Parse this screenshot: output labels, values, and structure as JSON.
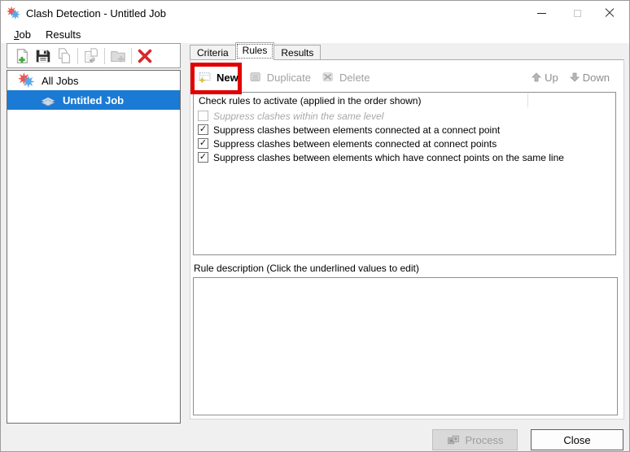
{
  "window": {
    "title": "Clash Detection - Untitled Job"
  },
  "menu": {
    "job": {
      "accel": "J",
      "rest": "ob"
    },
    "results": "Results"
  },
  "left_toolbar": {
    "icons": [
      "new-job-icon",
      "save-icon",
      "copy-icon",
      "paste-job-icon",
      "add-folder-icon",
      "delete-job-icon"
    ]
  },
  "tree": {
    "items": [
      {
        "label": "All Jobs",
        "selected": false
      },
      {
        "label": "Untitled Job",
        "selected": true
      }
    ]
  },
  "tabs": {
    "items": [
      {
        "label": "Criteria",
        "active": false
      },
      {
        "label": "Rules",
        "active": true
      },
      {
        "label": "Results",
        "active": false
      }
    ]
  },
  "rules_toolbar": {
    "new_label": "New",
    "duplicate_label": "Duplicate",
    "delete_label": "Delete",
    "up_label": "Up",
    "down_label": "Down",
    "new_enabled": true,
    "duplicate_enabled": false,
    "delete_enabled": false
  },
  "rules_list": {
    "header": "Check rules to activate (applied in the order shown)",
    "items": [
      {
        "label": "Suppress clashes within the same level",
        "checked": false,
        "disabled": true
      },
      {
        "label": "Suppress clashes between elements connected at a connect point",
        "checked": true,
        "disabled": false
      },
      {
        "label": "Suppress clashes between elements connected at connect points",
        "checked": true,
        "disabled": false
      },
      {
        "label": "Suppress clashes between elements which have connect points on the same line",
        "checked": true,
        "disabled": false
      }
    ]
  },
  "rule_description": {
    "label": "Rule description (Click the underlined values to edit)",
    "value": ""
  },
  "footer": {
    "process_label": "Process",
    "close_label": "Close",
    "process_enabled": false
  },
  "colors": {
    "selection_blue": "#1a7ad4",
    "annotation_red": "#e10000",
    "disabled_text": "#a0a0a0",
    "delete_red": "#d62b2b",
    "new_plus_green": "#3faa35",
    "background": "#f0f0f0"
  }
}
